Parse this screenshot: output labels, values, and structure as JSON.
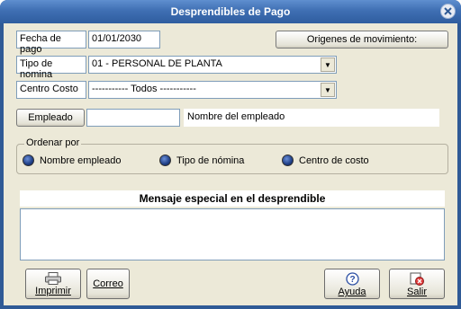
{
  "window": {
    "title": "Desprendibles de Pago"
  },
  "fecha_pago": {
    "label": "Fecha de pago",
    "value": "01/01/2030"
  },
  "origenes_button": {
    "label": "Origenes de movimiento:"
  },
  "tipo_nomina": {
    "label": "Tipo de nomina",
    "selected": "01 - PERSONAL DE PLANTA"
  },
  "centro_costo": {
    "label": "Centro Costo",
    "selected": "----------- Todos -----------"
  },
  "empleado": {
    "button_label": "Empleado",
    "value": "",
    "name_placeholder": "Nombre del empleado"
  },
  "ordenar": {
    "title": "Ordenar por",
    "options": [
      {
        "label": "Nombre empleado",
        "selected": false
      },
      {
        "label": "Tipo de nómina",
        "selected": true
      },
      {
        "label": "Centro de costo",
        "selected": false
      }
    ]
  },
  "mensaje": {
    "header": "Mensaje especial en el desprendible",
    "value": ""
  },
  "buttons": {
    "imprimir": "Imprimir",
    "correo": "Correo",
    "ayuda": "Ayuda",
    "salir": "Salir"
  },
  "icons": {
    "close": "close-icon",
    "printer": "printer-icon",
    "help": "help-icon",
    "exit": "exit-icon"
  }
}
